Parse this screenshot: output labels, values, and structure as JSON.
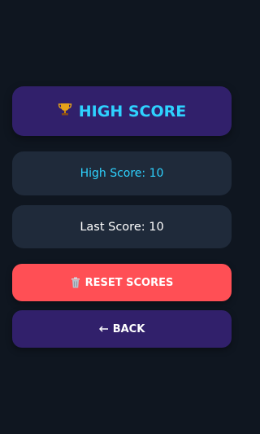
{
  "title": {
    "icon": "trophy-icon",
    "label": "HIGH SCORE"
  },
  "scores": {
    "high_label": "High Score: 10",
    "last_label": "Last Score: 10"
  },
  "buttons": {
    "reset": {
      "icon": "trash-icon",
      "label": "RESET SCORES"
    },
    "back": {
      "icon": "back-arrow-icon",
      "label": "BACK"
    }
  },
  "colors": {
    "background": "#0f1620",
    "title_card": "#31206b",
    "accent_cyan": "#2ed2ff",
    "score_card": "#1f2a3a",
    "reset_button": "#ff4f55",
    "back_button": "#31206b"
  }
}
